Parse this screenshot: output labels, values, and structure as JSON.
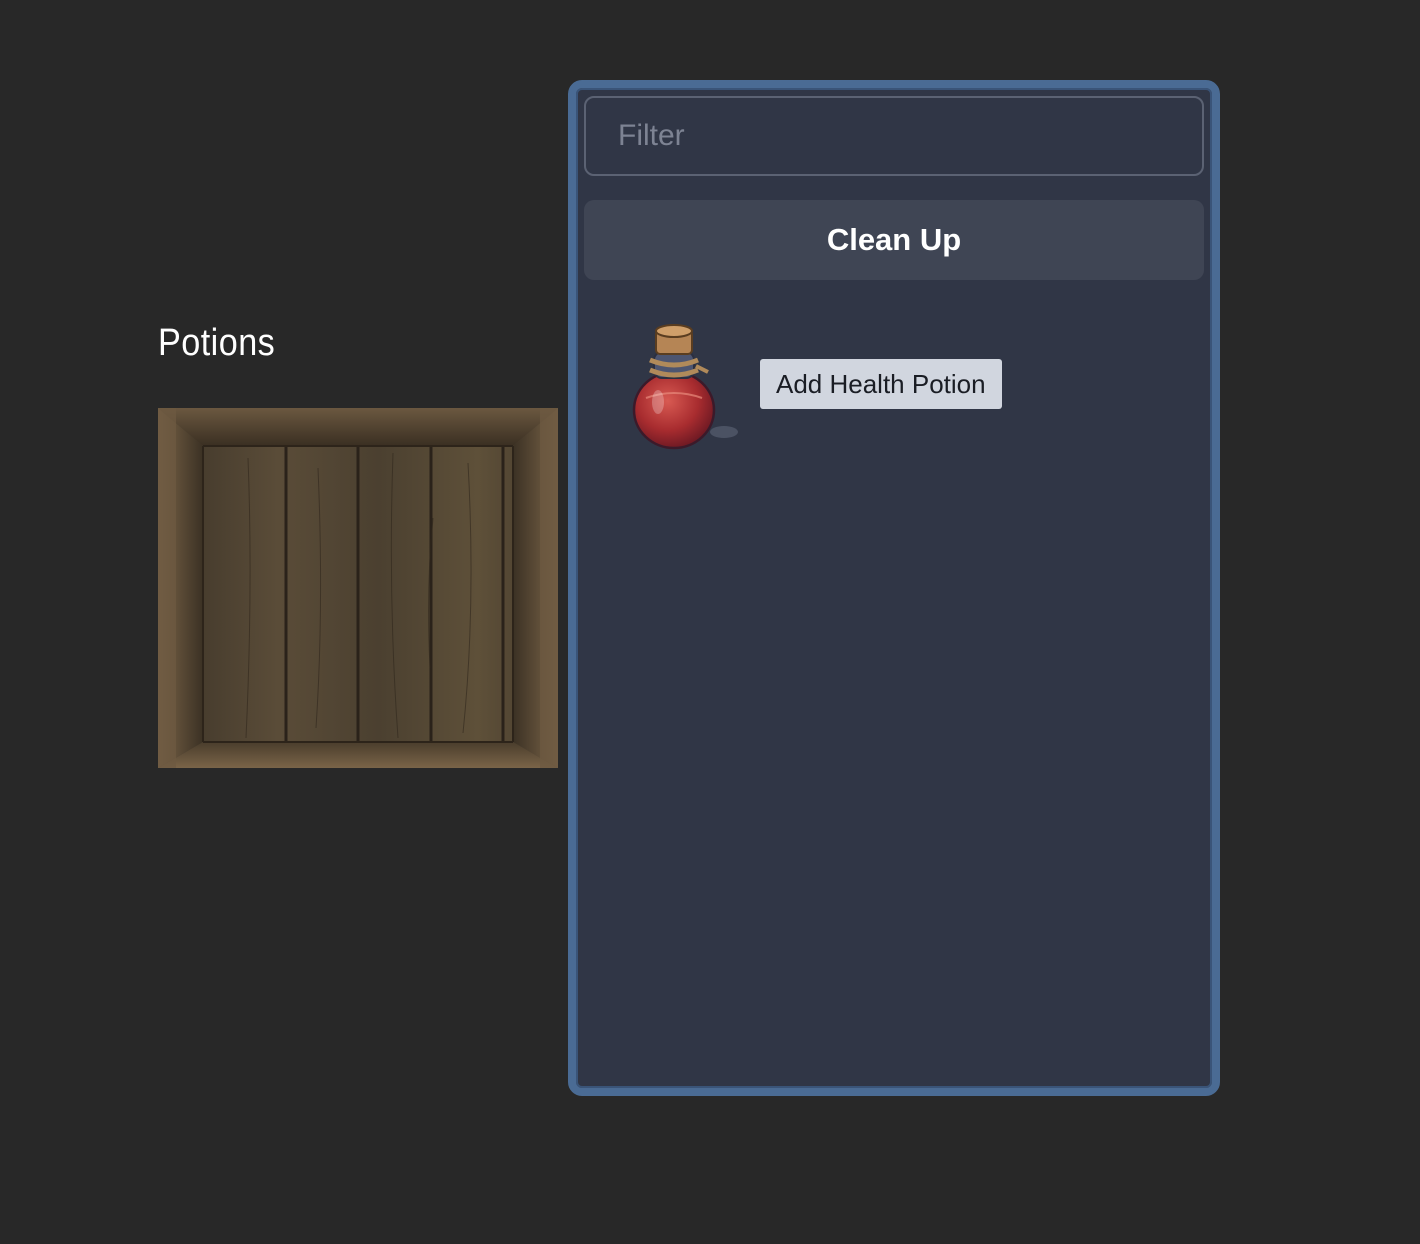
{
  "crate": {
    "title": "Potions",
    "image": "wooden-crate"
  },
  "inventory": {
    "filter": {
      "placeholder": "Filter",
      "value": ""
    },
    "cleanup_label": "Clean Up",
    "items": [
      {
        "icon": "red-potion-bottle",
        "action_label": "Add Health Potion"
      }
    ]
  },
  "colors": {
    "background": "#282828",
    "panel": "#303646",
    "panel_border": "#4a6b94",
    "button": "#3f4554",
    "item_button": "#d1d6df"
  }
}
